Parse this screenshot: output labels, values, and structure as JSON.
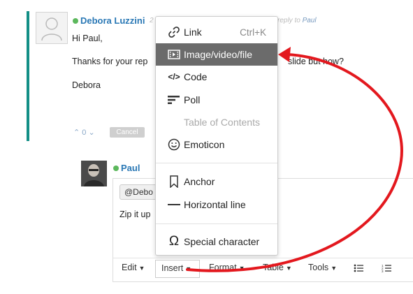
{
  "comment1": {
    "author": "Debora Luzzini",
    "meta_prefix": "2",
    "meta_reply": "reply to",
    "meta_user": "Paul",
    "lines": [
      "Hi Paul,",
      "Thanks for your rep",
      "slide but how?",
      "Debora"
    ],
    "vote_count": "0",
    "cancel_label": "Cancel"
  },
  "comment2": {
    "author": "Paul",
    "mention": "@Debo",
    "draft_text": "Zip it up"
  },
  "toolbar": {
    "edit": "Edit",
    "insert": "Insert",
    "format": "Format",
    "table": "Table",
    "tools": "Tools"
  },
  "insert_menu": {
    "items": [
      {
        "label": "Link",
        "shortcut": "Ctrl+K",
        "icon": "link-icon"
      },
      {
        "label": "Image/video/file",
        "icon": "film-icon",
        "active": true
      },
      {
        "label": "Code",
        "icon": "code-icon"
      },
      {
        "label": "Poll",
        "icon": "poll-icon"
      },
      {
        "label": "Table of Contents",
        "disabled": true
      },
      {
        "label": "Emoticon",
        "icon": "smiley-icon"
      },
      {
        "label": "Anchor",
        "icon": "bookmark-icon"
      },
      {
        "label": "Horizontal line",
        "icon": "horizontal-line-icon"
      },
      {
        "label": "Special character",
        "icon": "omega-icon"
      }
    ]
  },
  "colors": {
    "accent_teal": "#138f86",
    "author_blue": "#2a78b5",
    "online_green": "#5cb85c",
    "menu_active_bg": "#6b6b6b",
    "annotation_red": "#e3181e"
  }
}
